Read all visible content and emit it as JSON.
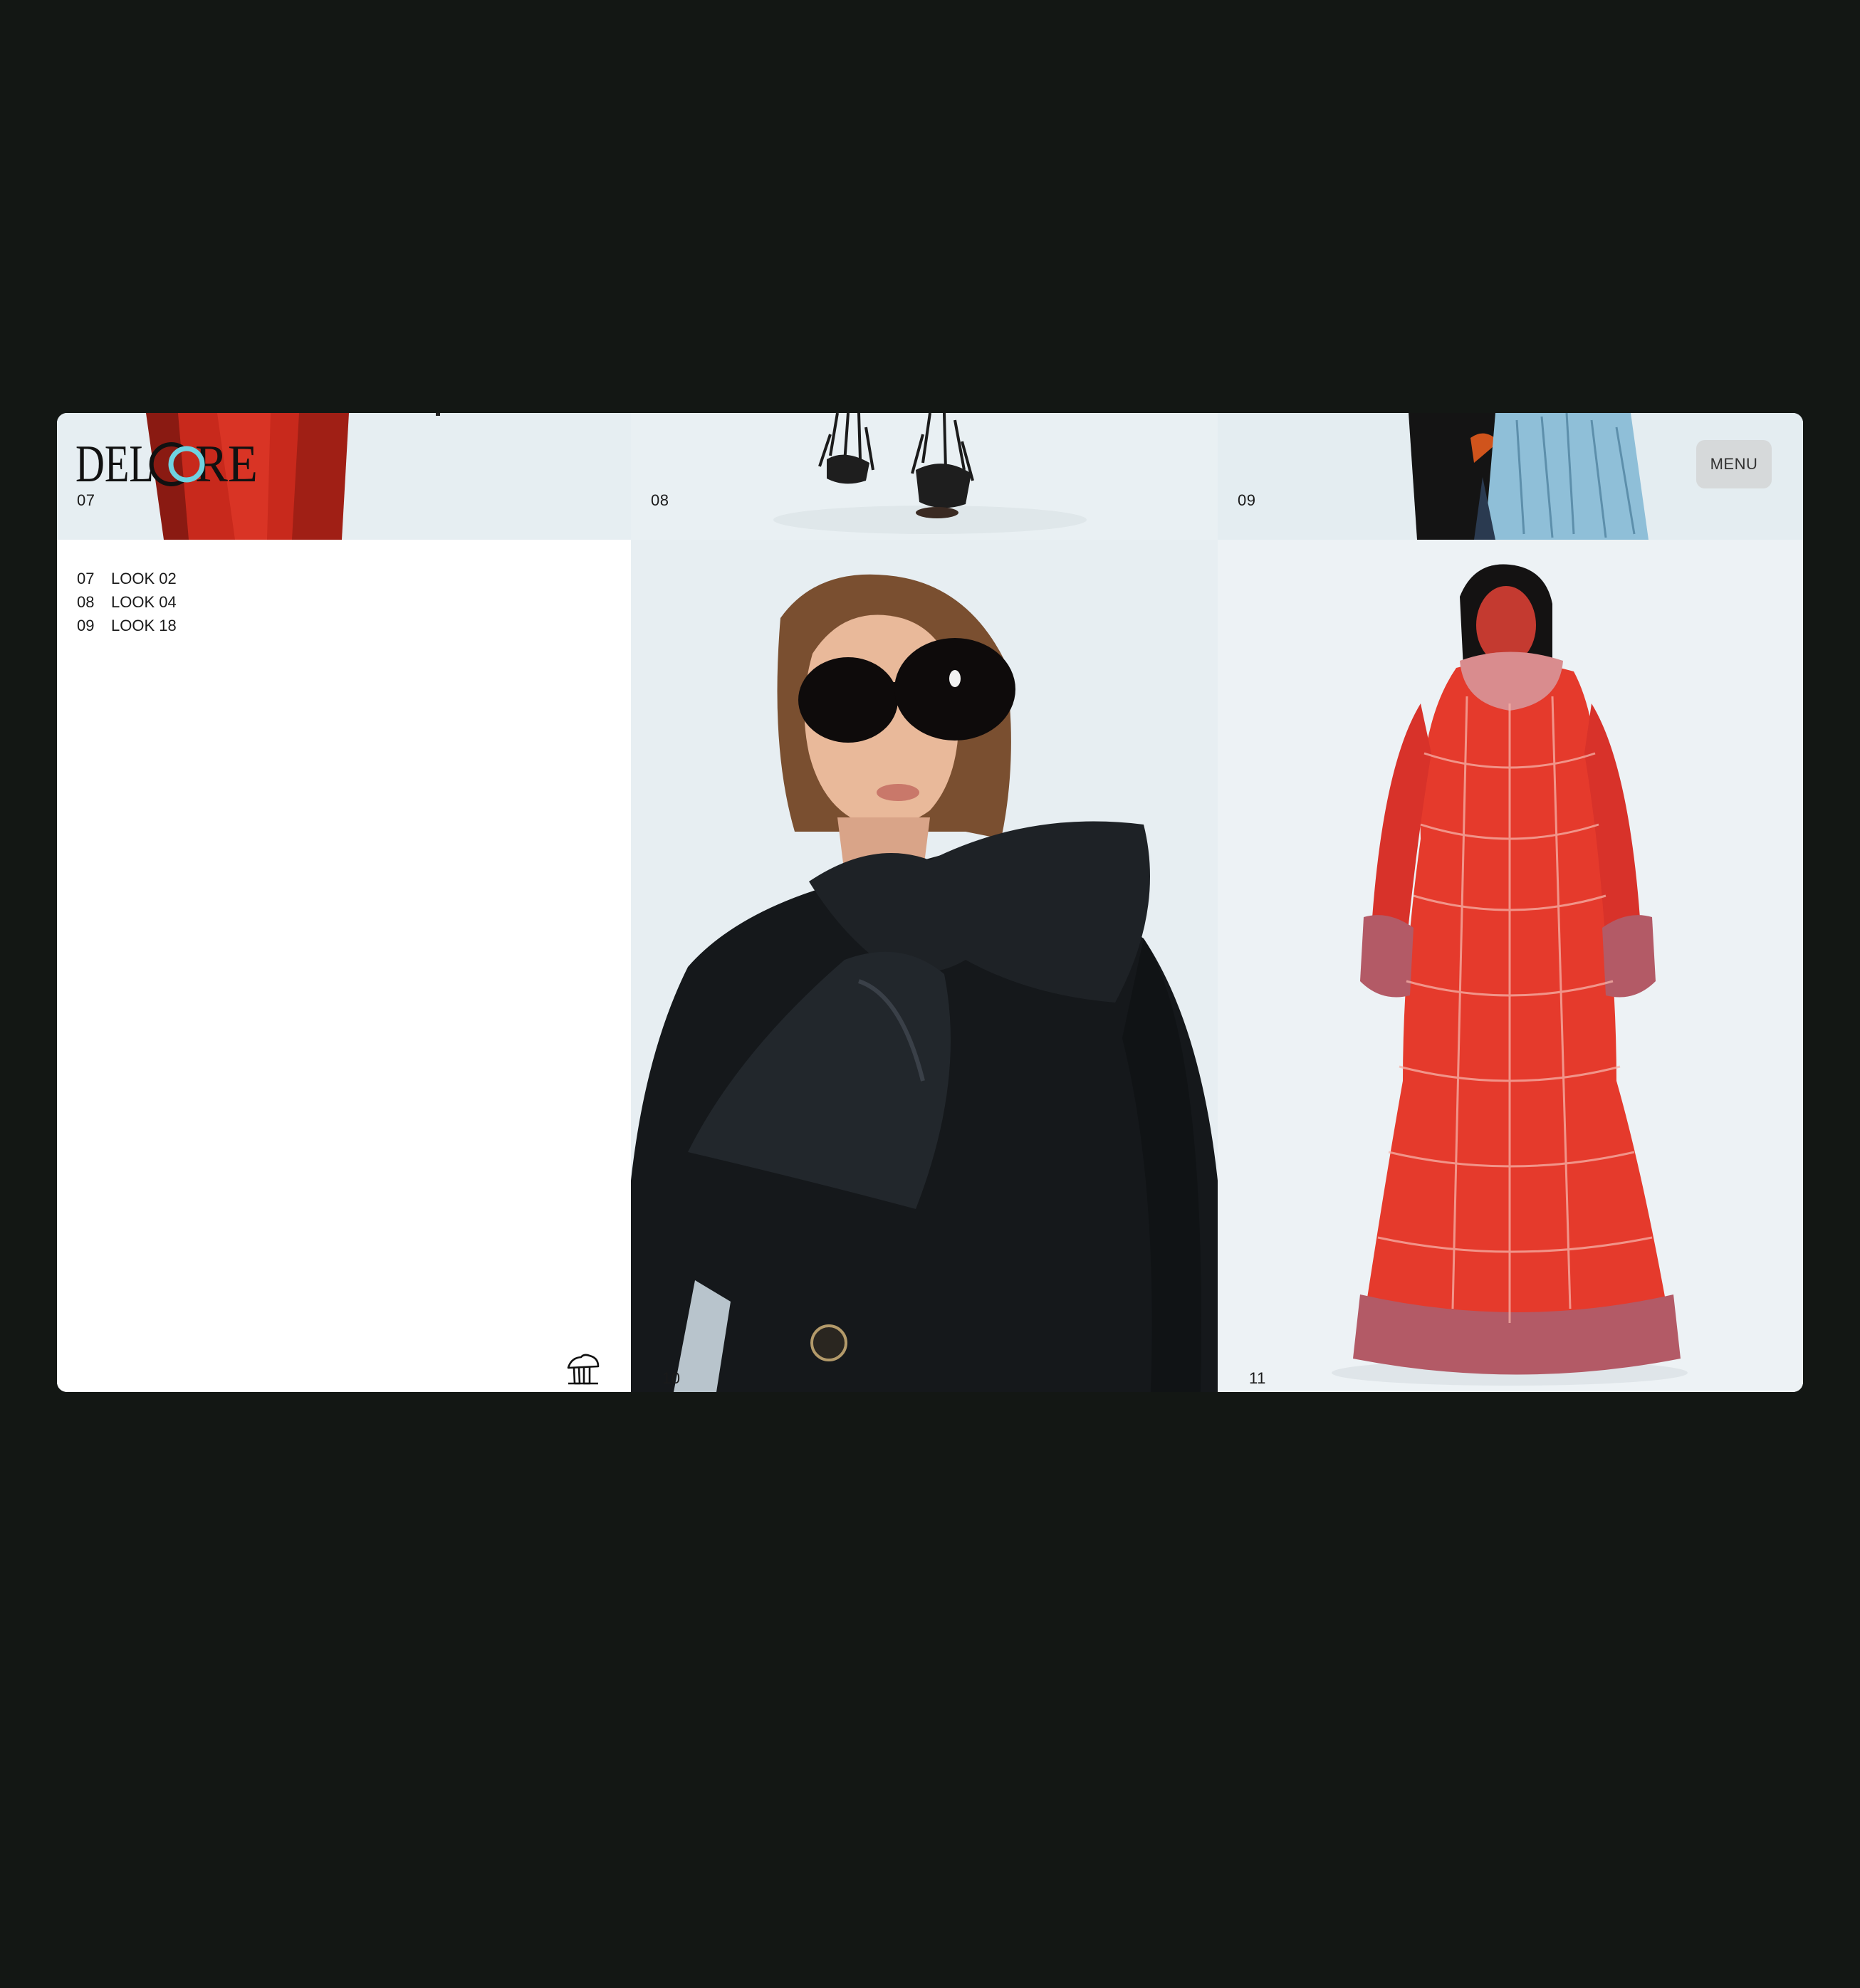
{
  "header": {
    "logo_text": "DELCORE",
    "menu_label": "MENU"
  },
  "strip": [
    {
      "number": "07"
    },
    {
      "number": "08"
    },
    {
      "number": "09"
    }
  ],
  "looks": [
    {
      "number": "07",
      "label": "LOOK 02"
    },
    {
      "number": "08",
      "label": "LOOK 04"
    },
    {
      "number": "09",
      "label": "LOOK 18"
    }
  ],
  "gallery": [
    {
      "number": "10"
    },
    {
      "number": "11"
    }
  ],
  "colors": {
    "background": "#131714",
    "logo_accent": "#6fd2e0",
    "coat_red": "#c8291c",
    "dress_red": "#e53a2c",
    "feather_blue": "#8fbfd8"
  }
}
